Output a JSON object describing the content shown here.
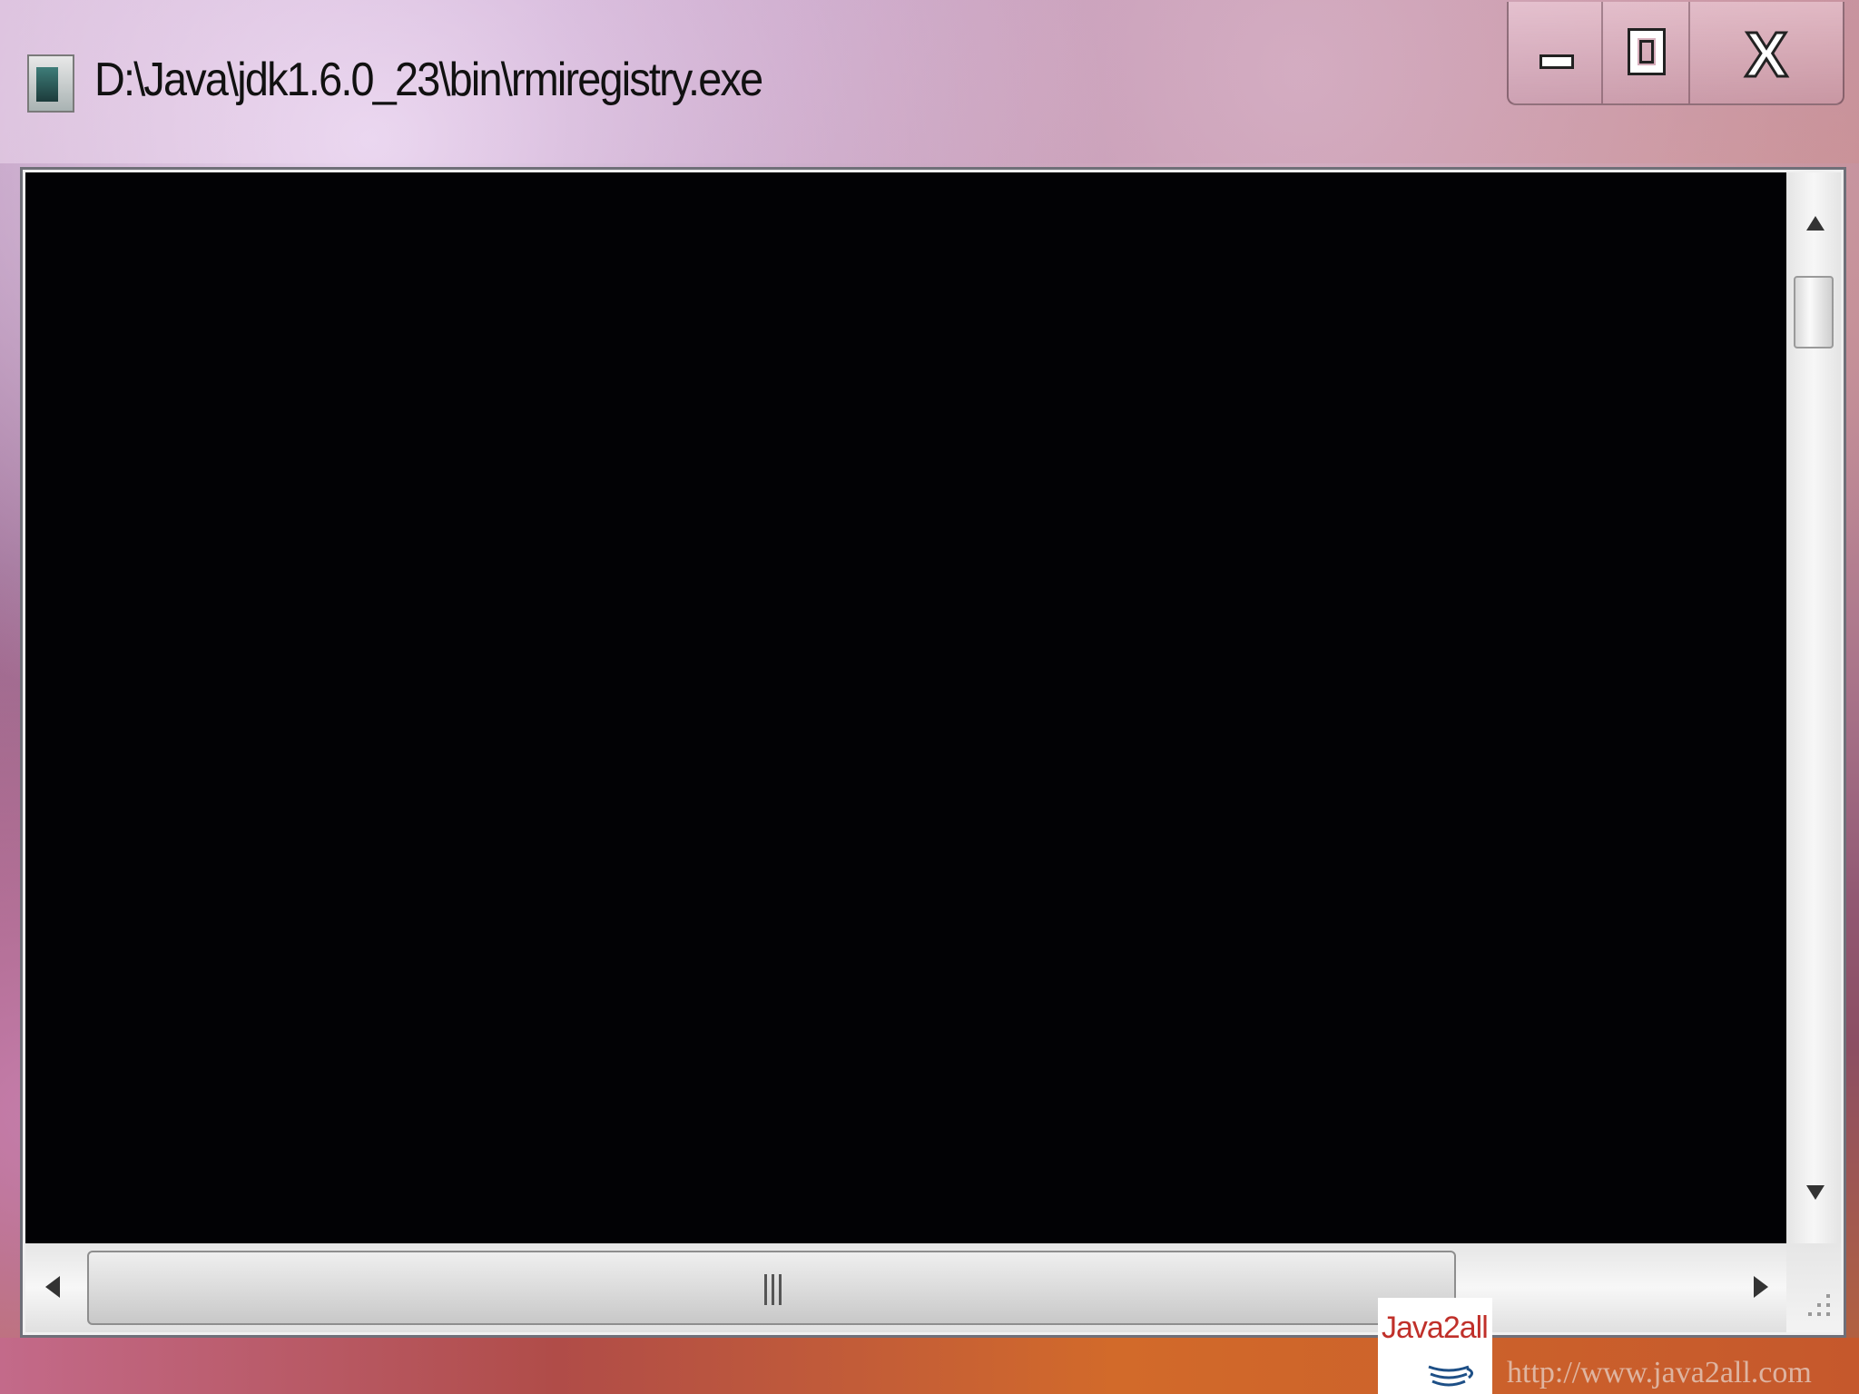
{
  "window": {
    "title": "D:\\Java\\jdk1.6.0_23\\bin\\rmiregistry.exe",
    "icon": "console-app-icon"
  },
  "caption_buttons": {
    "minimize_icon": "minimize-icon",
    "maximize_icon": "maximize-icon",
    "close_label": "X"
  },
  "console": {
    "background_color": "#020205",
    "output": ""
  },
  "scrollbars": {
    "vertical_position": 0.0,
    "horizontal_position": 0.0
  },
  "watermark": {
    "logo_text": "Java2all",
    "url": "http://www.java2all.com"
  }
}
